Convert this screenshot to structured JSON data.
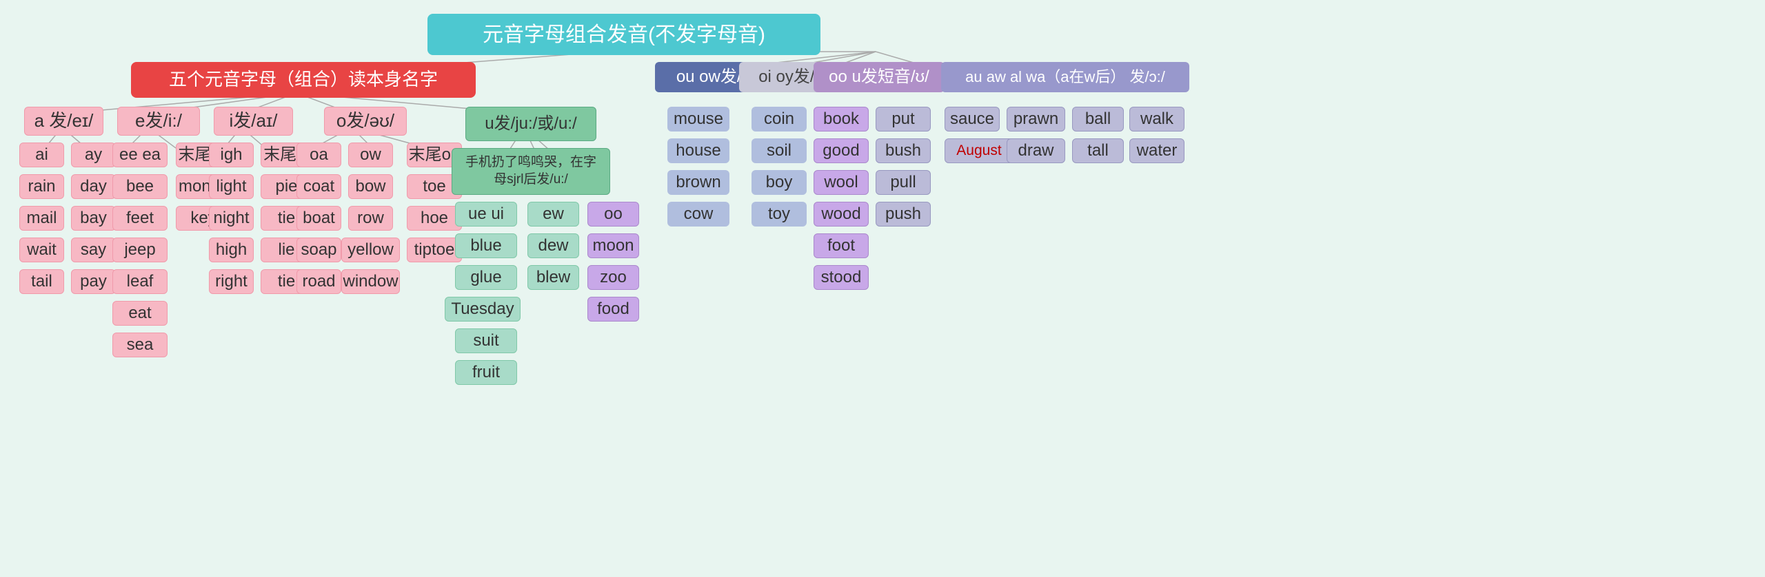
{
  "title": "元音字母组合发音(不发字母音)",
  "redHeader": "五个元音字母（组合）读本身名字",
  "sections": {
    "a": {
      "header": "a 发/eɪ/",
      "sub1": "ai",
      "sub2": "ay",
      "items_ai": [
        "rain",
        "mail",
        "wait",
        "tail"
      ],
      "items_ay": [
        "day",
        "bay",
        "say",
        "pay"
      ]
    },
    "e": {
      "header": "e发/i:/",
      "sub1": "ee ea",
      "sub2": "末尾ey",
      "items_ee": [
        "bee",
        "feet",
        "jeep",
        "leaf",
        "eat",
        "sea"
      ],
      "items_ey": [
        "money",
        "key"
      ]
    },
    "i": {
      "header": "i发/aɪ/",
      "sub1": "igh",
      "sub2": "末尾ie",
      "items_igh": [
        "light",
        "night",
        "high",
        "right"
      ],
      "items_ie": [
        "pie",
        "tie",
        "lie",
        "tie"
      ]
    },
    "o": {
      "header": "o发/əʊ/",
      "sub1": "oa",
      "sub2": "ow",
      "sub3": "末尾oe",
      "items_oa": [
        "coat",
        "boat",
        "soap",
        "road"
      ],
      "items_ow": [
        "bow",
        "row",
        "yellow",
        "window"
      ],
      "items_oe": [
        "toe",
        "hoe",
        "tiptoe"
      ]
    },
    "u": {
      "header": "u发/ju:/或/u:/",
      "note": "手机扔了鸣鸣哭，在字母sjrl后发/u:/",
      "sub1": "ue ui",
      "sub2": "ew",
      "sub3": "oo",
      "items_ue": [
        "blue",
        "glue",
        "Tuesday",
        "suit",
        "fruit"
      ],
      "items_ew": [
        "dew",
        "blew"
      ],
      "items_oo": [
        "moon",
        "zoo",
        "food"
      ]
    },
    "ou": {
      "header": "ou ow发/aʊ/",
      "items": [
        "mouse",
        "house",
        "brown",
        "cow"
      ]
    },
    "oi": {
      "header": "oi oy发/ɔɪ/",
      "items": [
        "coin",
        "soil",
        "boy",
        "toy"
      ]
    },
    "oo_short": {
      "header": "oo u发短音/ʊ/",
      "items_oo": [
        "book",
        "good",
        "wool",
        "wood",
        "foot",
        "stood"
      ],
      "items_u": [
        "put",
        "bush",
        "pull",
        "push"
      ]
    },
    "au": {
      "header": "au aw al wa（a在w后） 发/ɔ:/",
      "items_au": [
        "sauce",
        "August"
      ],
      "items_aw": [
        "prawn",
        "draw"
      ],
      "items_al": [
        "ball",
        "tall"
      ],
      "items_wa": [
        "walk",
        "water"
      ]
    }
  }
}
